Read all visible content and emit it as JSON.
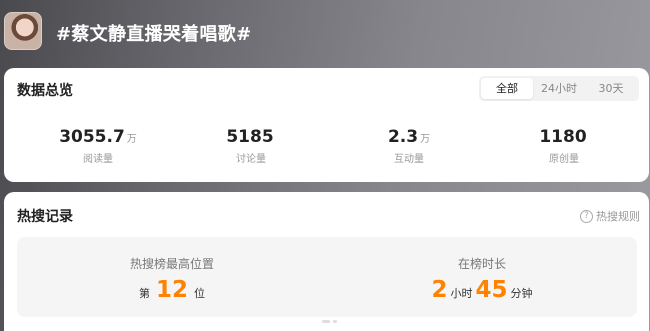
{
  "header": {
    "topic_title": "#蔡文静直播哭着唱歌#"
  },
  "overview": {
    "title": "数据总览",
    "tabs": [
      {
        "label": "全部",
        "active": true
      },
      {
        "label": "24小时",
        "active": false
      },
      {
        "label": "30天",
        "active": false
      }
    ],
    "stats": [
      {
        "value": "3055.7",
        "unit": "万",
        "label": "阅读量"
      },
      {
        "value": "5185",
        "unit": "",
        "label": "讨论量"
      },
      {
        "value": "2.3",
        "unit": "万",
        "label": "互动量"
      },
      {
        "value": "1180",
        "unit": "",
        "label": "原创量"
      }
    ]
  },
  "hot_search": {
    "title": "热搜记录",
    "rules_link": "热搜规则",
    "peak": {
      "label": "热搜榜最高位置",
      "prefix": "第",
      "rank": "12",
      "suffix": "位"
    },
    "duration": {
      "label": "在榜时长",
      "hours": "2",
      "hours_unit": "小时",
      "minutes": "45",
      "minutes_unit": "分钟"
    }
  },
  "colors": {
    "accent": "#ff8200",
    "card_bg": "#ffffff",
    "panel_bg": "#f5f5f5"
  }
}
